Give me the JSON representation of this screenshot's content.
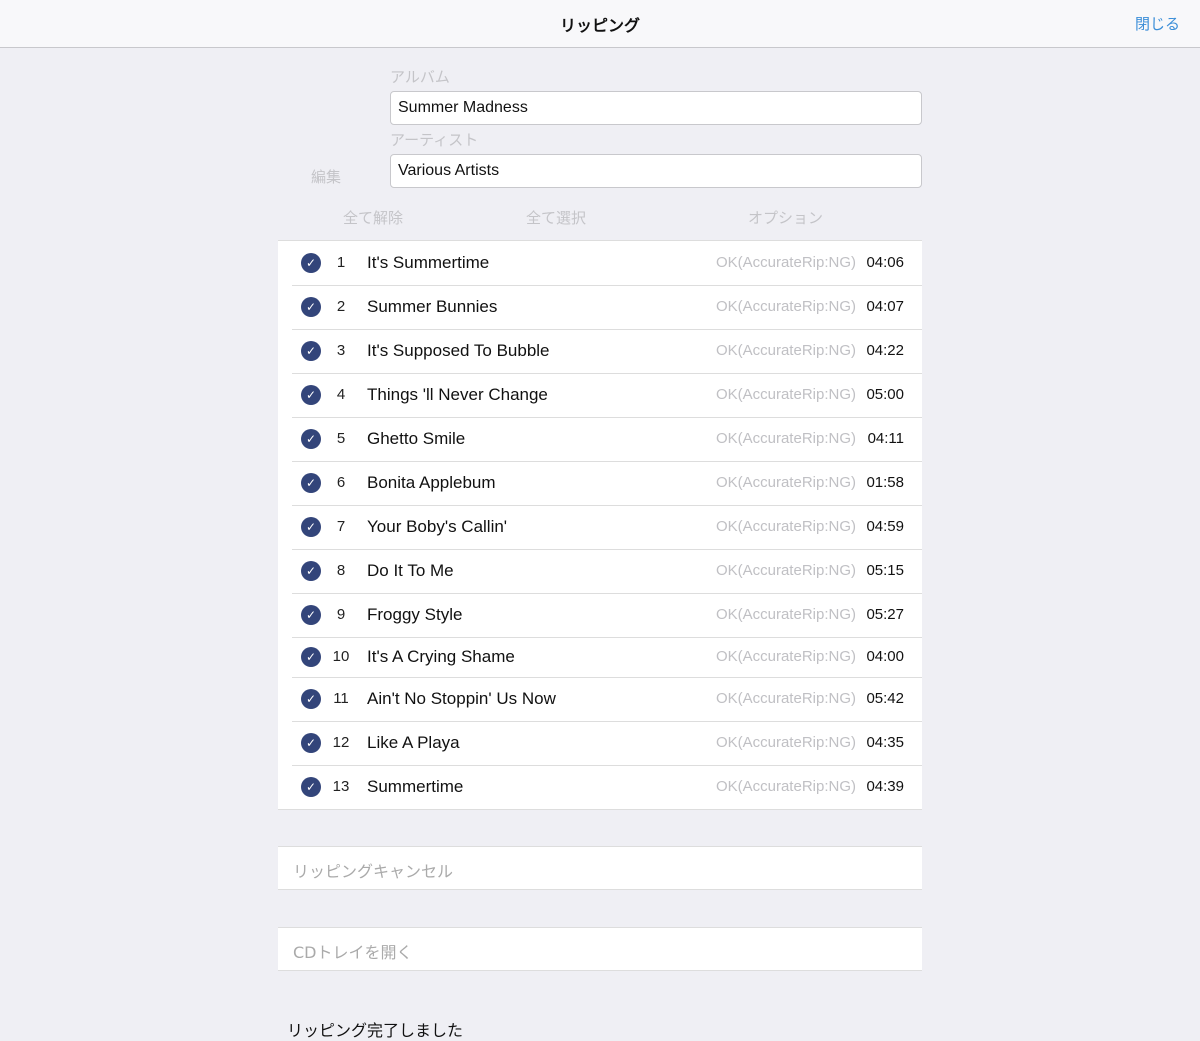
{
  "header": {
    "title": "リッピング",
    "close_label": "閉じる"
  },
  "form": {
    "album_label": "アルバム",
    "album_value": "Summer Madness",
    "artist_label": "アーティスト",
    "artist_value": "Various Artists",
    "edit_label": "編集"
  },
  "toolbar": {
    "deselect_all": "全て解除",
    "select_all": "全て選択",
    "options": "オプション"
  },
  "tracks": [
    {
      "num": "1",
      "title": "It's Summertime",
      "status": "OK(AccurateRip:NG)",
      "duration": "04:06",
      "checked": true
    },
    {
      "num": "2",
      "title": "Summer Bunnies",
      "status": "OK(AccurateRip:NG)",
      "duration": "04:07",
      "checked": true
    },
    {
      "num": "3",
      "title": "It's Supposed To Bubble",
      "status": "OK(AccurateRip:NG)",
      "duration": "04:22",
      "checked": true
    },
    {
      "num": "4",
      "title": "Things 'll Never Change",
      "status": "OK(AccurateRip:NG)",
      "duration": "05:00",
      "checked": true
    },
    {
      "num": "5",
      "title": "Ghetto Smile",
      "status": "OK(AccurateRip:NG)",
      "duration": "04:11",
      "checked": true
    },
    {
      "num": "6",
      "title": "Bonita Applebum",
      "status": "OK(AccurateRip:NG)",
      "duration": "01:58",
      "checked": true
    },
    {
      "num": "7",
      "title": "Your Boby's Callin'",
      "status": "OK(AccurateRip:NG)",
      "duration": "04:59",
      "checked": true
    },
    {
      "num": "8",
      "title": "Do It To Me",
      "status": "OK(AccurateRip:NG)",
      "duration": "05:15",
      "checked": true
    },
    {
      "num": "9",
      "title": "Froggy Style",
      "status": "OK(AccurateRip:NG)",
      "duration": "05:27",
      "checked": true
    },
    {
      "num": "10",
      "title": "It's A Crying Shame",
      "status": "OK(AccurateRip:NG)",
      "duration": "04:00",
      "checked": true
    },
    {
      "num": "11",
      "title": "Ain't No Stoppin' Us Now",
      "status": "OK(AccurateRip:NG)",
      "duration": "05:42",
      "checked": true
    },
    {
      "num": "12",
      "title": "Like A Playa",
      "status": "OK(AccurateRip:NG)",
      "duration": "04:35",
      "checked": true
    },
    {
      "num": "13",
      "title": "Summertime",
      "status": "OK(AccurateRip:NG)",
      "duration": "04:39",
      "checked": true
    }
  ],
  "actions": {
    "cancel_ripping": "リッピングキャンセル",
    "open_tray": "CDトレイを開く"
  },
  "status_message": "リッピング完了しました",
  "colors": {
    "accent": "#3b8ed8",
    "check": "#33457a",
    "background": "#efeff4"
  }
}
